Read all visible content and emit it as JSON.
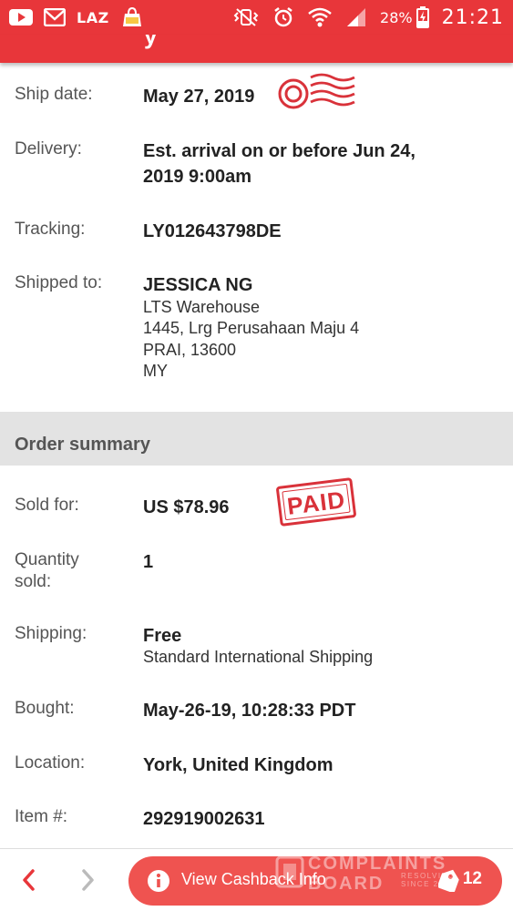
{
  "status_bar": {
    "carrier_text": "LAZ",
    "battery_percent": "28%",
    "time": "21:21"
  },
  "header": {
    "title_partial": "y"
  },
  "shipment": {
    "ship_date": {
      "label": "Ship date:",
      "value": "May 27, 2019"
    },
    "delivery": {
      "label": "Delivery:",
      "line1": "Est. arrival on or before Jun 24,",
      "line2": "2019 9:00am"
    },
    "tracking": {
      "label": "Tracking:",
      "value": "LY012643798DE"
    },
    "shipped_to": {
      "label": "Shipped to:",
      "name": "JESSICA NG",
      "line1": "LTS Warehouse",
      "line2": "1445, Lrg Perusahaan Maju 4",
      "line3": "PRAI, 13600",
      "line4": "MY"
    }
  },
  "order_summary": {
    "title": "Order summary",
    "sold_for": {
      "label": "Sold for:",
      "value": "US $78.96",
      "stamp": "PAID"
    },
    "quantity": {
      "label_line1": "Quantity",
      "label_line2": "sold:",
      "value": "1"
    },
    "shipping": {
      "label": "Shipping:",
      "value": "Free",
      "method": "Standard International Shipping"
    },
    "bought": {
      "label": "Bought:",
      "value": "May-26-19, 10:28:33 PDT"
    },
    "location": {
      "label": "Location:",
      "value": "York, United Kingdom"
    },
    "item": {
      "label": "Item #:",
      "value": "292919002631"
    }
  },
  "bottom_bar": {
    "cashback_label": "View Cashback Info",
    "coupon_count": "12"
  },
  "watermark": {
    "line1": "COMPLAINTS",
    "line2": "BOARD",
    "small1": "RESOLVING",
    "small2": "SINCE 2004"
  },
  "colors": {
    "accent": "#e8363a",
    "pill": "#ef5350",
    "stamp": "#d9323a"
  }
}
